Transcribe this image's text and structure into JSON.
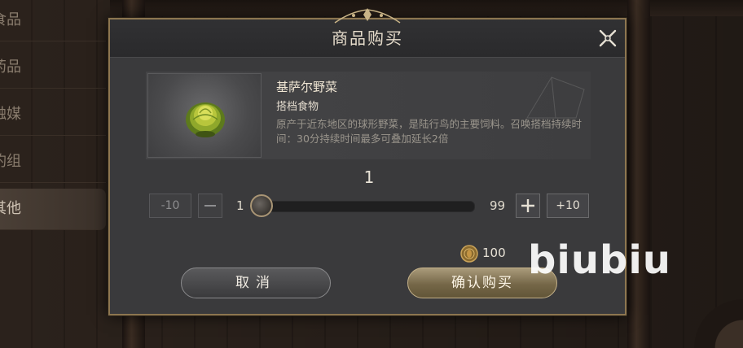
{
  "side_menu": {
    "items": [
      {
        "label": "食品",
        "active": false
      },
      {
        "label": "药品",
        "active": false
      },
      {
        "label": "触媒",
        "active": false
      },
      {
        "label": "钓组",
        "active": false
      },
      {
        "label": "其他",
        "active": true
      }
    ]
  },
  "dialog": {
    "title": "商品购买",
    "close_icon": "close-icon"
  },
  "item": {
    "name": "基萨尔野菜",
    "type": "搭档食物",
    "description": "原产于近东地区的球形野菜，是陆行鸟的主要饲料。召唤搭档持续时间：30分持续时间最多可叠加延长2倍",
    "icon": "cabbage-icon"
  },
  "quantity": {
    "current": "1",
    "min": "1",
    "max": "99",
    "fraction": 0,
    "minus10_label": "-10",
    "plus10_label": "+10",
    "minus_icon": "minus-icon",
    "plus_icon": "plus-icon"
  },
  "price": {
    "amount": "100",
    "icon": "coin-icon"
  },
  "buttons": {
    "cancel_label": "取消",
    "confirm_label": "确认购买"
  },
  "watermark": "biubiu",
  "colors": {
    "border_gold": "#8d7650",
    "confirm_gold": "#756748",
    "dialog_bg": "#3a3a3c"
  }
}
